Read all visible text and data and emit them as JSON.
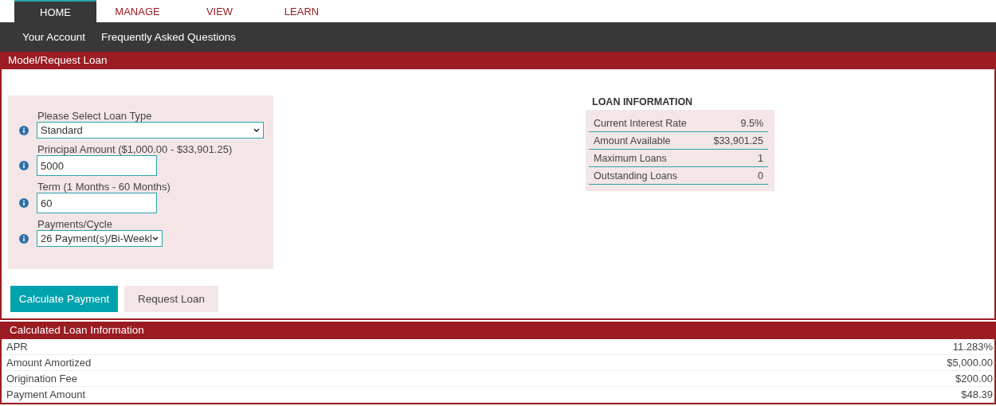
{
  "tabs": [
    {
      "label": "HOME",
      "selected": true
    },
    {
      "label": "MANAGE",
      "selected": false
    },
    {
      "label": "VIEW",
      "selected": false
    },
    {
      "label": "LEARN",
      "selected": false
    }
  ],
  "subnav": [
    "Your Account",
    "Frequently Asked Questions"
  ],
  "model_section": {
    "title": "Model/Request Loan",
    "fields": [
      {
        "kind": "select",
        "label": "Please Select Loan Type",
        "value": "Standard"
      },
      {
        "kind": "input",
        "label": "Principal Amount ($1,000.00 - $33,901.25)",
        "value": "5000"
      },
      {
        "kind": "input",
        "label": "Term (1 Months - 60 Months)",
        "value": "60"
      },
      {
        "kind": "select",
        "label": "Payments/Cycle",
        "value": "26 Payment(s)/Bi-Weekl"
      }
    ],
    "buttons": [
      {
        "label": "Calculate Payment",
        "kind": "primary"
      },
      {
        "label": "Request Loan",
        "kind": "secondary"
      }
    ],
    "loan_information": {
      "title": "LOAN INFORMATION",
      "rows": [
        {
          "label": "Current Interest Rate",
          "value": "9.5%"
        },
        {
          "label": "Amount Available",
          "value": "$33,901.25"
        },
        {
          "label": "Maximum Loans",
          "value": "1"
        },
        {
          "label": "Outstanding Loans",
          "value": "0"
        }
      ]
    }
  },
  "calculated_section": {
    "title": "Calculated Loan Information",
    "rows": [
      {
        "label": "APR",
        "value": "11.283%"
      },
      {
        "label": "Amount Amortized",
        "value": "$5,000.00"
      },
      {
        "label": "Origination Fee",
        "value": "$200.00"
      },
      {
        "label": "Payment Amount",
        "value": "$48.39"
      }
    ]
  }
}
